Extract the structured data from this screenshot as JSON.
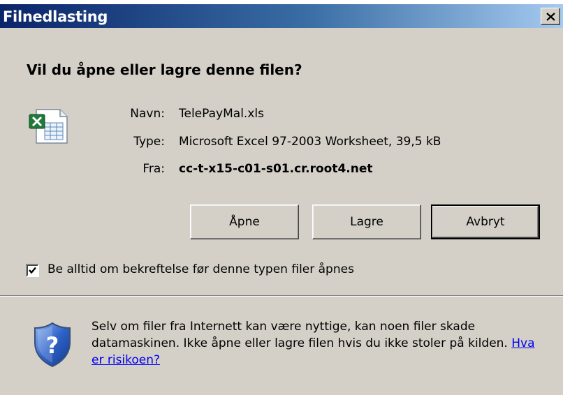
{
  "window": {
    "title": "Filnedlasting"
  },
  "dialog": {
    "question": "Vil du åpne eller lagre denne filen?",
    "file": {
      "name_label": "Navn:",
      "name_value": "TelePayMal.xls",
      "type_label": "Type:",
      "type_value": "Microsoft Excel 97-2003 Worksheet, 39,5 kB",
      "from_label": "Fra:",
      "from_value": "cc-t-x15-c01-s01.cr.root4.net",
      "icon": "excel-file-icon"
    },
    "buttons": {
      "open": "Åpne",
      "save": "Lagre",
      "cancel": "Avbryt"
    },
    "always_ask": {
      "label": "Be alltid om bekreftelse før denne typen filer åpnes",
      "checked": true
    },
    "warning": {
      "text": "Selv om filer fra Internett kan være nyttige, kan noen filer skade datamaskinen. Ikke åpne eller lagre filen hvis du ikke stoler på kilden.",
      "link": "Hva er risikoen?",
      "icon": "shield-question-icon"
    }
  },
  "colors": {
    "dialog_bg": "#d4d0c8",
    "title_start": "#0a246a",
    "title_end": "#a6caf0",
    "link": "#0000ee"
  }
}
